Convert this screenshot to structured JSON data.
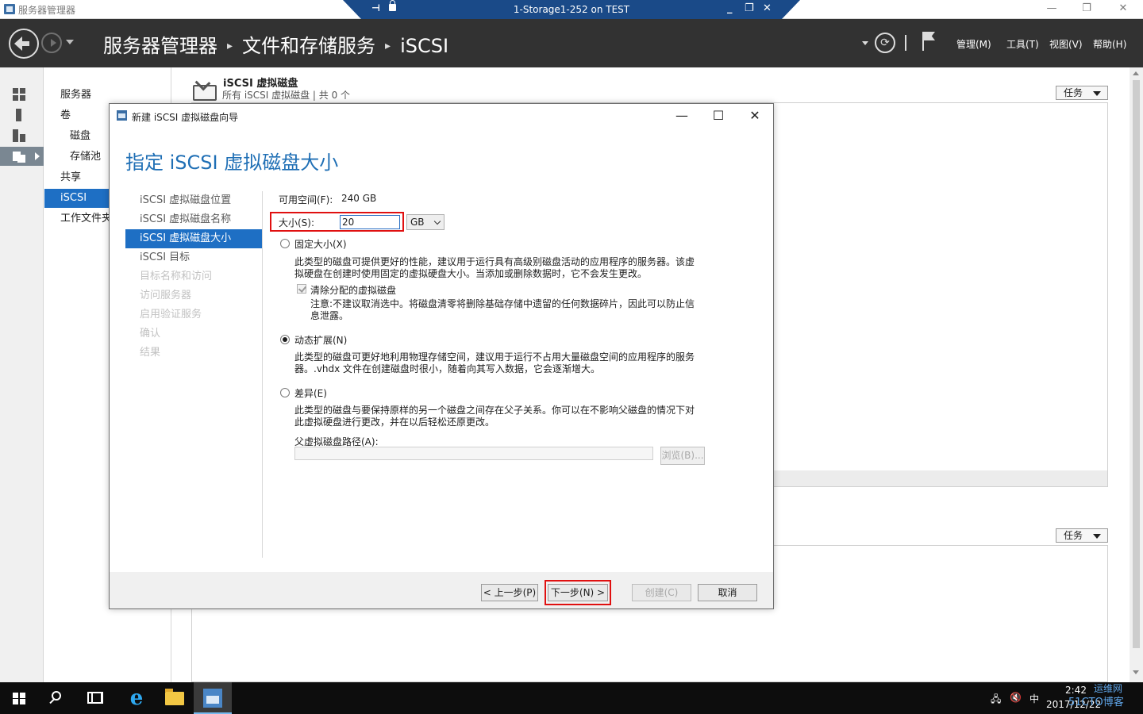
{
  "window": {
    "title": "服务器管理器",
    "min_glyph": "—",
    "restore_glyph": "❐",
    "close_glyph": "✕"
  },
  "rdp_bar": {
    "pin_glyph": "⊣",
    "session_title": "1-Storage1-252 on TEST",
    "min_glyph": "_",
    "restore_glyph": "❐",
    "close_glyph": "✕"
  },
  "header": {
    "breadcrumb": [
      "服务器管理器",
      "文件和存储服务",
      "iSCSI"
    ],
    "breadcrumb_sep": "▸",
    "refresh_glyph": "⟳",
    "menus": [
      "管理(M)",
      "工具(T)",
      "视图(V)",
      "帮助(H)"
    ]
  },
  "rail": {
    "items": [
      "dashboard-icon",
      "local-server-icon",
      "all-servers-icon",
      "file-storage-icon"
    ]
  },
  "subnav": {
    "items": [
      "服务器",
      "卷",
      "磁盘",
      "存储池",
      "共享",
      "iSCSI",
      "工作文件夹"
    ],
    "active": "iSCSI"
  },
  "main": {
    "tile_title": "iSCSI 虚拟磁盘",
    "tile_subtitle": "所有 iSCSI 虚拟磁盘 | 共 0 个",
    "tasks_label": "任务",
    "tasks_label_2": "任务"
  },
  "dialog": {
    "title": "新建 iSCSI 虚拟磁盘向导",
    "min_glyph": "—",
    "max_glyph": "☐",
    "close_glyph": "✕",
    "heading": "指定 iSCSI 虚拟磁盘大小",
    "steps": [
      {
        "label": "iSCSI 虚拟磁盘位置",
        "state": "normal"
      },
      {
        "label": "iSCSI 虚拟磁盘名称",
        "state": "normal"
      },
      {
        "label": "iSCSI 虚拟磁盘大小",
        "state": "active"
      },
      {
        "label": "iSCSI 目标",
        "state": "normal"
      },
      {
        "label": "目标名称和访问",
        "state": "disabled"
      },
      {
        "label": "访问服务器",
        "state": "disabled"
      },
      {
        "label": "启用验证服务",
        "state": "disabled"
      },
      {
        "label": "确认",
        "state": "disabled"
      },
      {
        "label": "结果",
        "state": "disabled"
      }
    ],
    "free_space_label": "可用空间(F):",
    "free_space_value": "240 GB",
    "size_label": "大小(S):",
    "size_value": "20",
    "size_unit": "GB",
    "fixed_label": "固定大小(X)",
    "fixed_desc": "此类型的磁盘可提供更好的性能，建议用于运行具有高级别磁盘活动的应用程序的服务器。该虚拟硬盘在创建时使用固定的虚拟硬盘大小。当添加或删除数据时，它不会发生更改。",
    "clear_label": "清除分配的虚拟磁盘",
    "clear_desc": "注意:不建议取消选中。将磁盘清零将删除基础存储中遗留的任何数据碎片，因此可以防止信息泄露。",
    "dynamic_label": "动态扩展(N)",
    "dynamic_desc": "此类型的磁盘可更好地利用物理存储空间，建议用于运行不占用大量磁盘空间的应用程序的服务器。.vhdx 文件在创建磁盘时很小，随着向其写入数据，它会逐渐增大。",
    "diff_label": "差异(E)",
    "diff_desc": "此类型的磁盘与要保持原样的另一个磁盘之间存在父子关系。你可以在不影响父磁盘的情况下对此虚拟硬盘进行更改，并在以后轻松还原更改。",
    "parent_path_label": "父虚拟磁盘路径(A):",
    "parent_path_value": "",
    "browse_label": "浏览(B)...",
    "selected_type": "dynamic",
    "buttons": {
      "prev": "< 上一步(P)",
      "next": "下一步(N) >",
      "create": "创建(C)",
      "cancel": "取消"
    }
  },
  "taskbar": {
    "apps": [
      "start-icon",
      "search-icon",
      "task-view-icon",
      "ie-icon",
      "file-explorer-icon",
      "server-manager-icon"
    ],
    "ie_glyph": "e",
    "ime": "中",
    "clock_time": "2:42",
    "clock_date": "2017/12/22"
  },
  "watermark": {
    "line1": "运维网",
    "line2": "51CTO博客"
  },
  "colors": {
    "accent": "#1e6fc4",
    "heading": "#1f6fb5",
    "highlight": "#e01010",
    "header_bg": "#323232"
  }
}
